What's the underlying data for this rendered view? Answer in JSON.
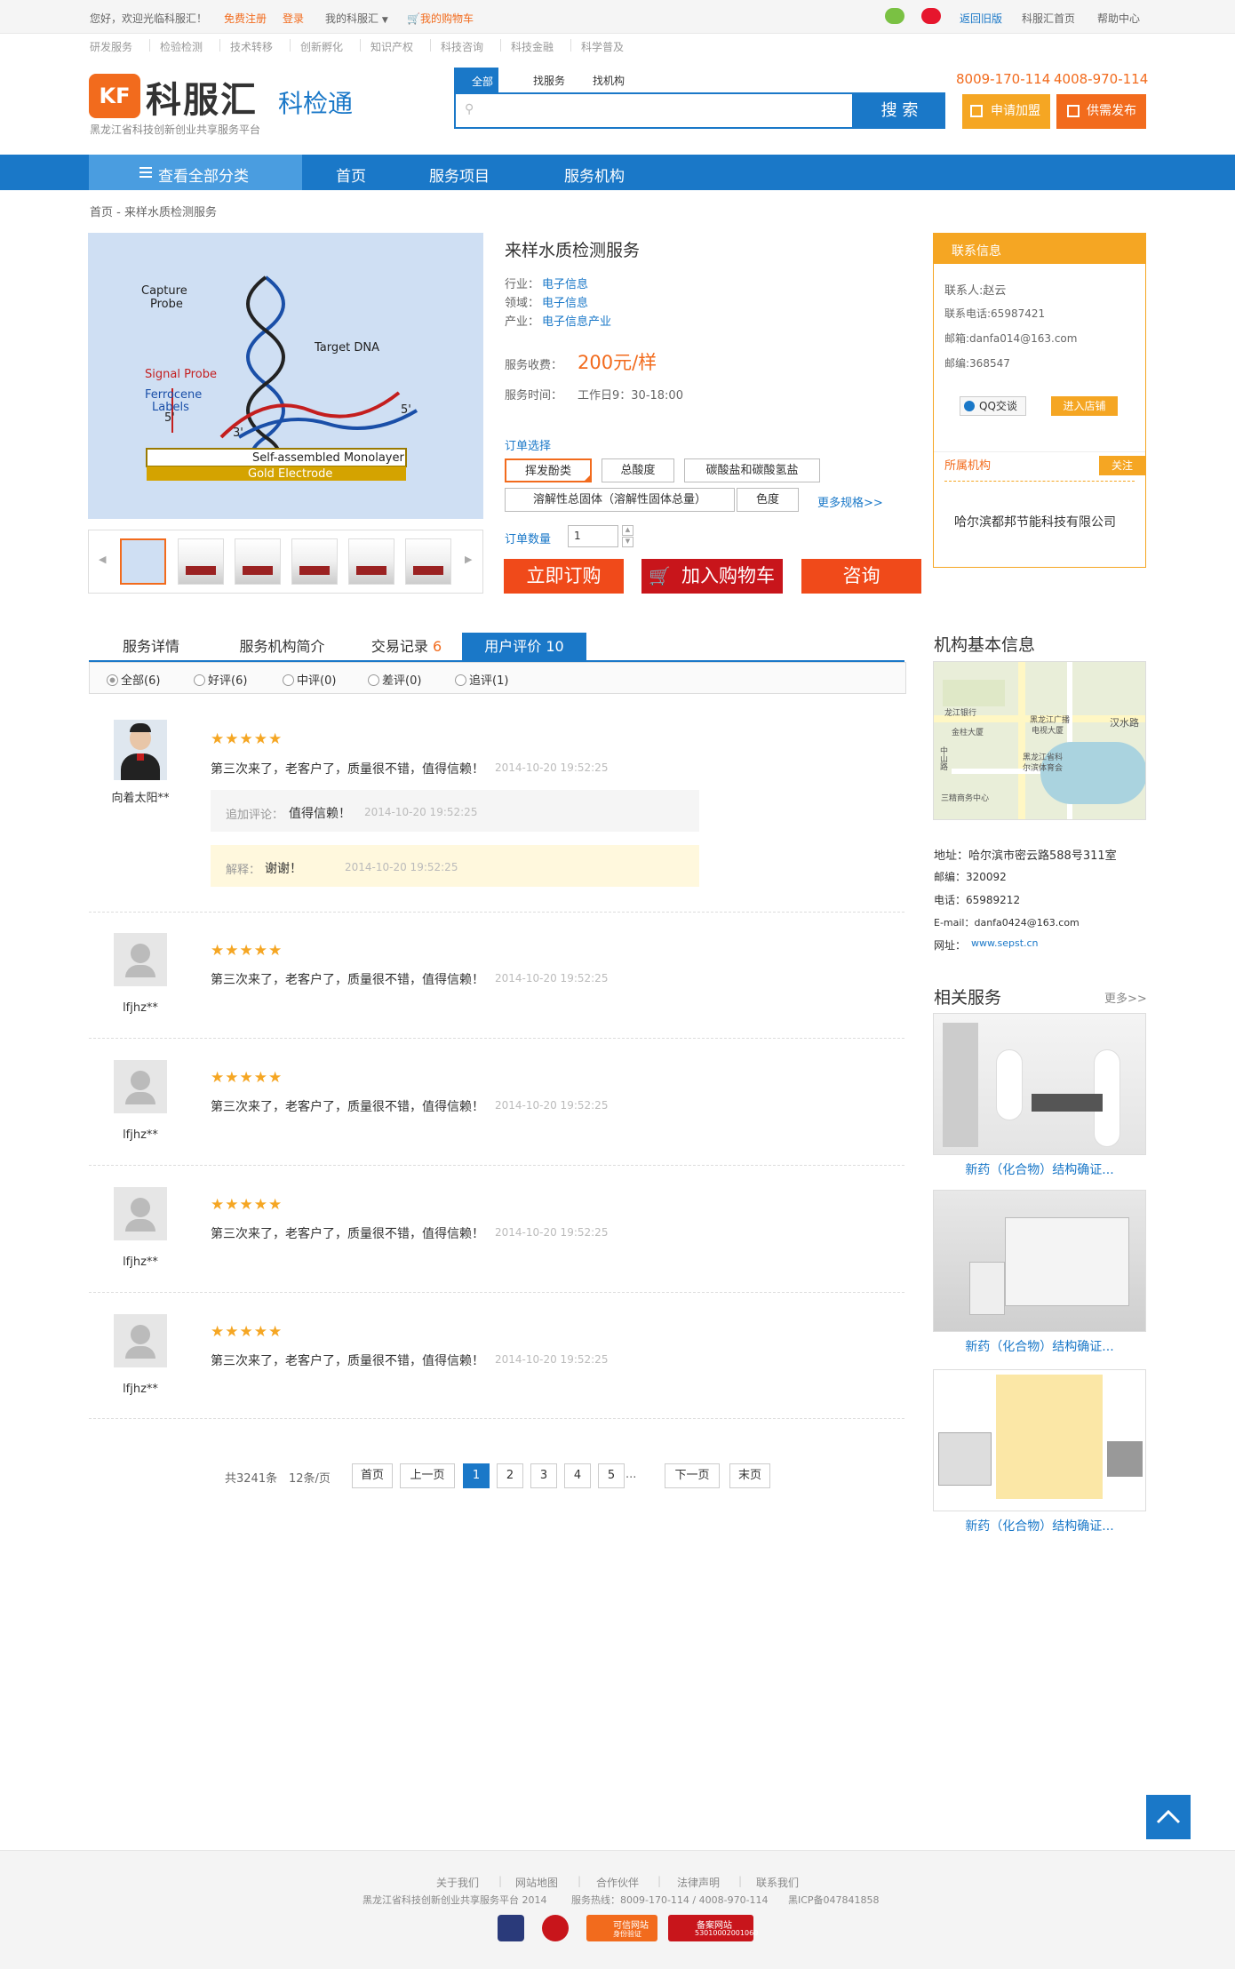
{
  "topbar": {
    "welcome": "您好，欢迎光临科服汇！",
    "register": "免费注册",
    "login": "登录",
    "my": "我的科服汇",
    "cart": "我的购物车",
    "back_old": "返回旧版",
    "home": "科服汇首页",
    "help": "帮助中心"
  },
  "subnav": [
    "研发服务",
    "检验检测",
    "技术转移",
    "创新孵化",
    "知识产权",
    "科技咨询",
    "科技金融",
    "科学普及"
  ],
  "logo": {
    "badge": "KF",
    "name": "科服汇",
    "slogan": "黑龙江省科技创新创业共享服务平台",
    "product": "科检通"
  },
  "search": {
    "tabs": [
      "全部",
      "找服务",
      "找机构"
    ],
    "button": "搜 索",
    "phone1": "8009-170-114",
    "phone2": "4008-970-114",
    "join": "申请加盟",
    "publish": "供需发布"
  },
  "nav": {
    "all": "查看全部分类",
    "items": [
      "首页",
      "服务项目",
      "服务机构"
    ]
  },
  "breadcrumb": "首页 - 来样水质检测服务",
  "image_labels": {
    "capture": "Capture",
    "probe": "Probe",
    "target": "Target DNA",
    "signal": "Signal Probe",
    "ferrocene": "Ferrocene",
    "labels": "Labels",
    "p5a": "5'",
    "p3": "3'",
    "p5b": "5'",
    "monolayer": "Self-assembled Monolayer",
    "electrode": "Gold Electrode"
  },
  "product": {
    "title": "来样水质检测服务",
    "industry_label": "行业：",
    "industry": "电子信息",
    "field_label": "领域：",
    "field": "电子信息",
    "sector_label": "产业：",
    "sector": "电子信息产业",
    "fee_label": "服务收费：",
    "fee": "200元/样",
    "time_label": "服务时间：",
    "time": "工作日9：30-18:00",
    "order_label": "订单选择",
    "options": [
      "挥发酚类",
      "总酸度",
      "碳酸盐和碳酸氢盐",
      "溶解性总固体（溶解性固体总量）",
      "色度"
    ],
    "more_spec": "更多规格>>",
    "qty_label": "订单数量",
    "qty": "1",
    "buy": "立即订购",
    "add_cart": "加入购物车",
    "consult": "咨询"
  },
  "contact": {
    "title": "联系信息",
    "person": "联系人:赵云",
    "phone": "联系电话:65987421",
    "email": "邮箱:danfa014@163.com",
    "zip": "邮编:368547",
    "qq": "QQ交谈",
    "shop": "进入店铺",
    "org_title": "所属机构",
    "follow": "关注",
    "org_name": "哈尔滨都邦节能科技有限公司"
  },
  "tabs": [
    {
      "label": "服务详情"
    },
    {
      "label": "服务机构简介"
    },
    {
      "label": "交易记录",
      "count": "6"
    },
    {
      "label": "用户评价",
      "count": "10"
    }
  ],
  "filters": [
    "全部(6)",
    "好评(6)",
    "中评(0)",
    "差评(0)",
    "追评(1)"
  ],
  "reviews": [
    {
      "user": "向着太阳**",
      "stars": "★★★★★",
      "text": "第三次来了，老客户了，质量很不错，值得信赖！",
      "time": "2014-10-20 19:52:25",
      "append_label": "追加评论：",
      "append": "值得信赖！",
      "append_time": "2014-10-20 19:52:25",
      "reply_label": "解释：",
      "reply": "谢谢！",
      "reply_time": "2014-10-20 19:52:25"
    },
    {
      "user": "lfjhz**",
      "stars": "★★★★★",
      "text": "第三次来了，老客户了，质量很不错，值得信赖！",
      "time": "2014-10-20 19:52:25"
    },
    {
      "user": "lfjhz**",
      "stars": "★★★★★",
      "text": "第三次来了，老客户了，质量很不错，值得信赖！",
      "time": "2014-10-20 19:52:25"
    },
    {
      "user": "lfjhz**",
      "stars": "★★★★★",
      "text": "第三次来了，老客户了，质量很不错，值得信赖！",
      "time": "2014-10-20 19:52:25"
    },
    {
      "user": "lfjhz**",
      "stars": "★★★★★",
      "text": "第三次来了，老客户了，质量很不错，值得信赖！",
      "time": "2014-10-20 19:52:25"
    }
  ],
  "pagination": {
    "total": "共3241条",
    "per": "12条/页",
    "first": "首页",
    "prev": "上一页",
    "pages": [
      "1",
      "2",
      "3",
      "4",
      "5"
    ],
    "ellipsis": "...",
    "next": "下一页",
    "last": "末页"
  },
  "org_info": {
    "title": "机构基本信息",
    "map_labels": [
      "龙江银行",
      "金柱大厦",
      "黑龙江广播",
      "电视大厦",
      "汉水路",
      "黑龙江省科",
      "尔滨体育会",
      "三精商务中心",
      "中山路"
    ],
    "address": "地址：哈尔滨市密云路588号311室",
    "zip": "邮编：320092",
    "phone": "电话：65989212",
    "email": "E-mail：danfa0424@163.com",
    "site_label": "网址：",
    "site": "www.sepst.cn"
  },
  "related": {
    "title": "相关服务",
    "more": "更多>>",
    "items": [
      "新药（化合物）结构确证...",
      "新药（化合物）结构确证...",
      "新药（化合物）结构确证..."
    ]
  },
  "footer": {
    "links": [
      "关于我们",
      "网站地图",
      "合作伙伴",
      "法律声明",
      "联系我们"
    ],
    "copy": "黑龙江省科技创新创业共享服务平台 2014",
    "hotline": "服务热线：8009-170-114 / 4008-970-114",
    "icp": "黑ICP备047841858",
    "badge1": "可信网站",
    "badge1b": "身份验证",
    "badge2": "备案网站",
    "badge2b": "53010002001060"
  },
  "colors": {
    "primary": "#1a78c8",
    "accent": "#f26b1d",
    "buy": "#f04a1a",
    "cart": "#c8151b"
  }
}
